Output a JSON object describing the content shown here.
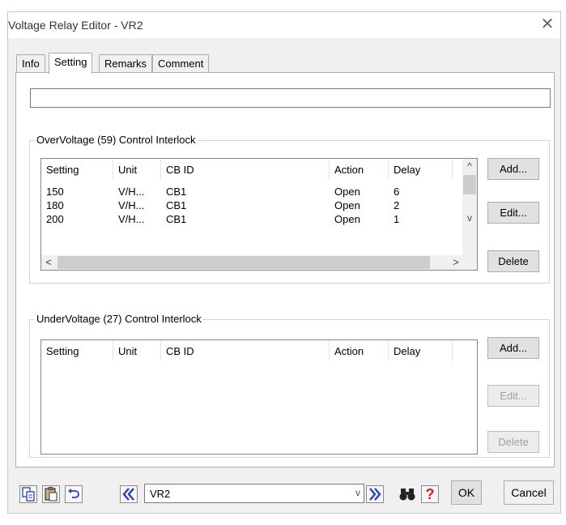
{
  "window": {
    "title": "Voltage Relay Editor - VR2",
    "close_symbol": "✕"
  },
  "tabs": [
    {
      "label": "Info",
      "active": false
    },
    {
      "label": "Setting",
      "active": true
    },
    {
      "label": "Remarks",
      "active": false
    },
    {
      "label": "Comment",
      "active": false
    }
  ],
  "top_field": {
    "value": ""
  },
  "over_voltage": {
    "legend": "OverVoltage (59) Control Interlock",
    "columns": [
      "Setting",
      "Unit",
      "CB ID",
      "Action",
      "Delay"
    ],
    "rows": [
      [
        "150",
        "V/H...",
        "CB1",
        "Open",
        "6"
      ],
      [
        "180",
        "V/H...",
        "CB1",
        "Open",
        "2"
      ],
      [
        "200",
        "V/H...",
        "CB1",
        "Open",
        "1"
      ]
    ],
    "buttons": {
      "add": "Add...",
      "edit": "Edit...",
      "delete": "Delete"
    }
  },
  "under_voltage": {
    "legend": "UnderVoltage (27) Control Interlock",
    "columns": [
      "Setting",
      "Unit",
      "CB ID",
      "Action",
      "Delay"
    ],
    "rows": [],
    "buttons": {
      "add": "Add...",
      "edit": "Edit...",
      "delete": "Delete"
    }
  },
  "footer": {
    "icons": [
      "copy-icon",
      "paste-icon",
      "undo-icon"
    ],
    "prev_icon": "double-chevron-left-icon",
    "next_icon": "double-chevron-right-icon",
    "find_icon": "binoculars-icon",
    "help_icon": "help-icon",
    "help_symbol": "?",
    "record_selector": "VR2",
    "ok_label": "OK",
    "cancel_label": "Cancel"
  },
  "colors": {
    "accent_blue": "#2a3fb8",
    "help_red": "#e0161f"
  }
}
